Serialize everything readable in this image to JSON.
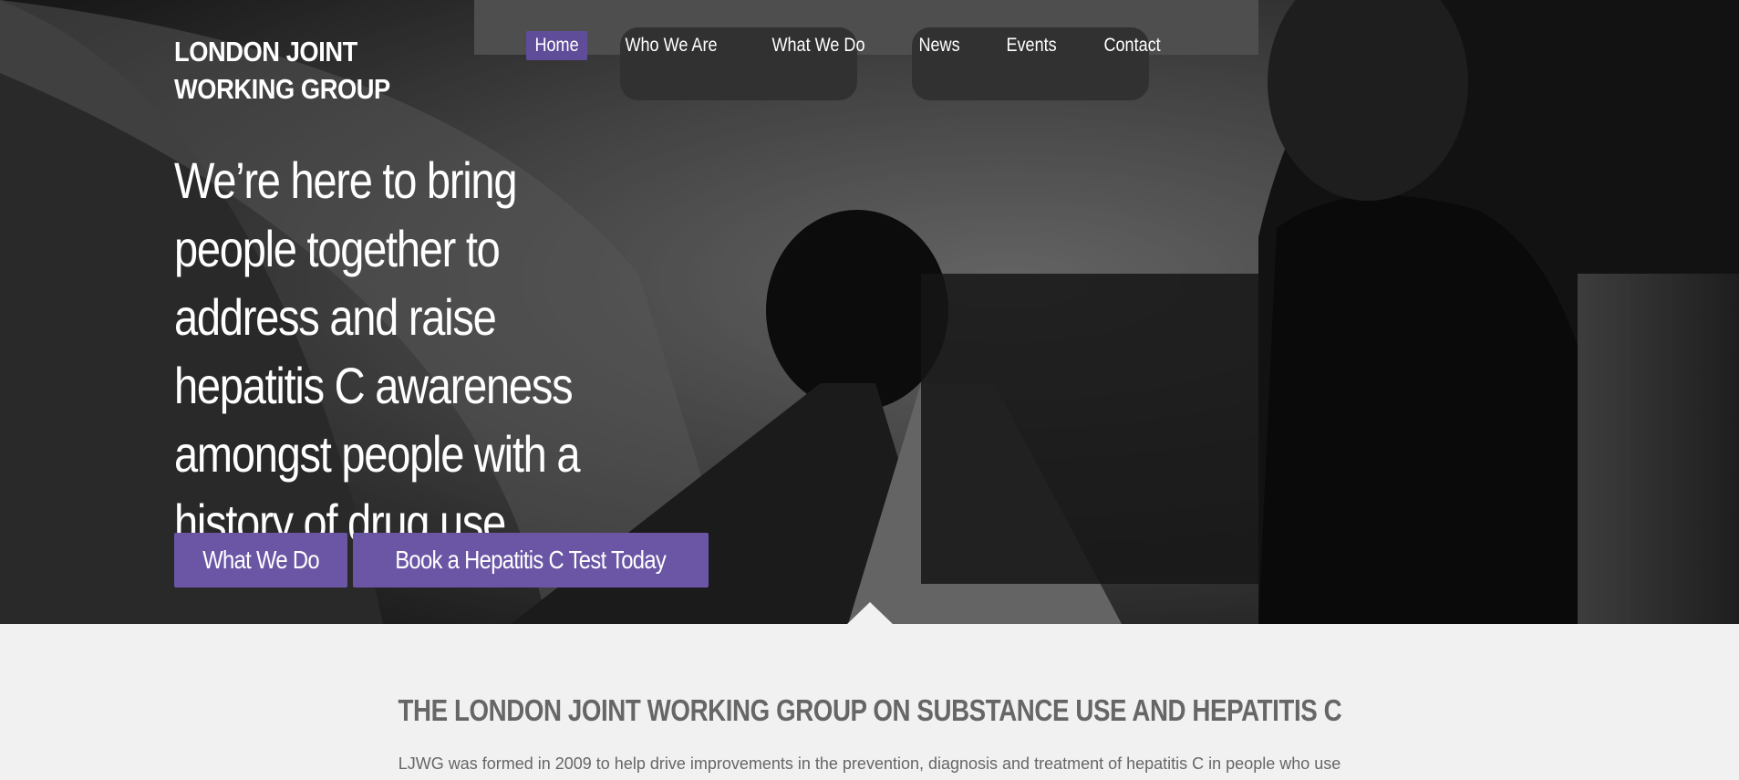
{
  "site": {
    "logo_line1": "LONDON JOINT",
    "logo_line2": "WORKING GROUP"
  },
  "nav": {
    "items": [
      {
        "label": "Home",
        "active": true
      },
      {
        "label": "Who We Are"
      },
      {
        "label": "What We Do"
      },
      {
        "label": "News"
      },
      {
        "label": "Events"
      },
      {
        "label": "Contact"
      }
    ]
  },
  "hero": {
    "headline": "We’re here to bring people together to address and raise hepatitis C awareness amongst people with a history of drug use.",
    "buttons": [
      {
        "label": "What We Do"
      },
      {
        "label": "Book a Hepatitis C Test Today"
      }
    ]
  },
  "section": {
    "title": "THE LONDON JOINT WORKING GROUP ON SUBSTANCE USE AND HEPATITIS C",
    "intro": "LJWG was formed in 2009 to help drive improvements in the prevention, diagnosis and treatment of hepatitis C in people who use"
  },
  "colors": {
    "accent": "#6a56a5",
    "nav_active": "#5f4d9a",
    "section_bg": "#f1f1f1",
    "section_text": "#666666"
  }
}
